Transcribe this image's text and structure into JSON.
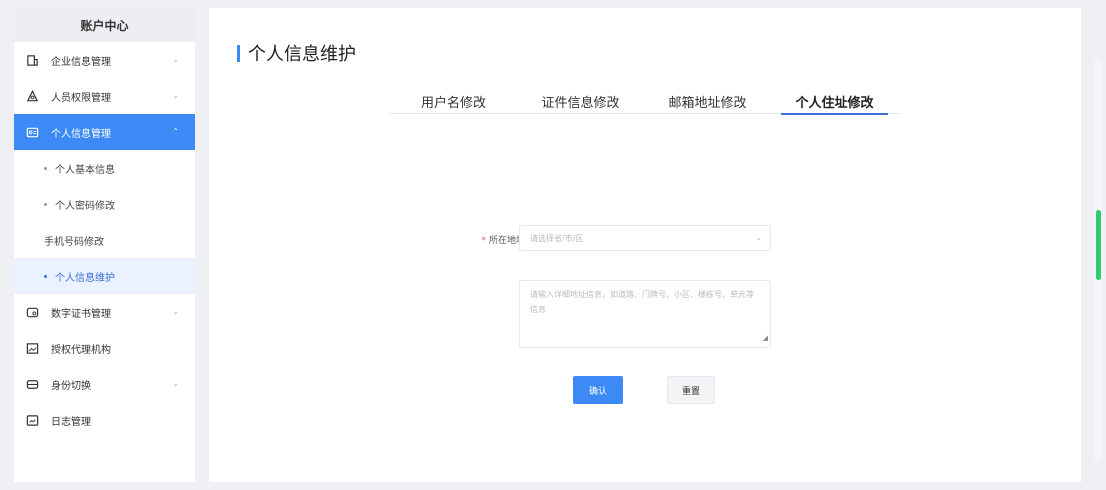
{
  "sidebar": {
    "header": "账户中心",
    "items": [
      {
        "label": "企业信息管理",
        "icon": "building-icon",
        "chevron": "⌄"
      },
      {
        "label": "人员权限管理",
        "icon": "user-shield-icon",
        "chevron": "⌄"
      },
      {
        "label": "个人信息管理",
        "icon": "id-card-icon",
        "chevron": "⌃"
      }
    ],
    "sub_items": [
      {
        "label": "个人基本信息"
      },
      {
        "label": "个人密码修改"
      },
      {
        "label": "手机号码修改"
      },
      {
        "label": "个人信息维护"
      }
    ],
    "items_after": [
      {
        "label": "数字证书管理",
        "icon": "certificate-icon",
        "chevron": "⌄"
      },
      {
        "label": "授权代理机构",
        "icon": "image-icon",
        "chevron": ""
      },
      {
        "label": "身份切换",
        "icon": "switch-icon",
        "chevron": "⌄"
      },
      {
        "label": "日志管理",
        "icon": "log-icon",
        "chevron": ""
      }
    ]
  },
  "main": {
    "title": "个人信息维护",
    "tabs": [
      {
        "label": "用户名修改"
      },
      {
        "label": "证件信息修改"
      },
      {
        "label": "邮箱地址修改"
      },
      {
        "label": "个人住址修改"
      }
    ],
    "active_tab": 3,
    "form": {
      "address_label": "所在地址",
      "address_placeholder": "请选择省/市/区",
      "detail_placeholder": "请输入详细地址信息，如道路、门牌号、小区、楼栋号、单元等信息",
      "confirm_label": "确认",
      "reset_label": "重置"
    }
  },
  "colors": {
    "accent": "#3d8af7",
    "scroll_thumb": "#2ecc71"
  }
}
